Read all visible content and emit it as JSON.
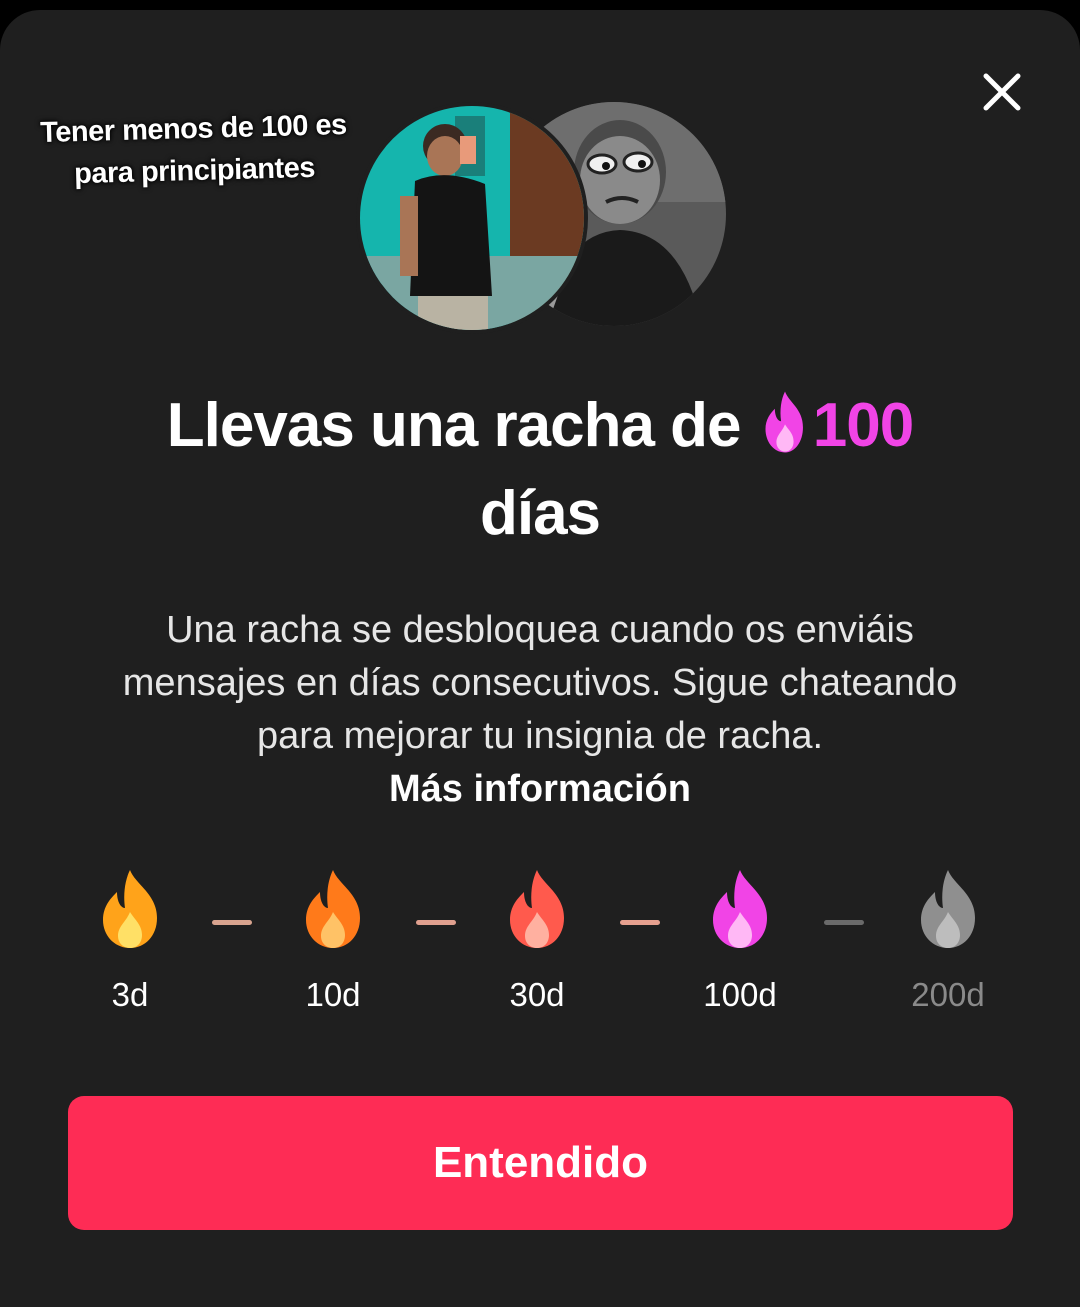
{
  "caption": {
    "line1": "Tener menos de 100 es",
    "line2": "para principiantes"
  },
  "close_icon": "close-icon",
  "title": {
    "prefix": "Llevas una racha de ",
    "count": "100",
    "suffix": "días"
  },
  "description": {
    "text": "Una racha se desbloquea cuando os enviáis mensajes en días consecutivos. Sigue chateando para mejorar tu insignia de racha.",
    "more_link": "Más información"
  },
  "milestones": [
    {
      "label": "3d",
      "color": "#ffa31a",
      "state": "reached"
    },
    {
      "label": "10d",
      "color": "#ff7a1a",
      "state": "reached"
    },
    {
      "label": "30d",
      "color": "#ff5a4d",
      "state": "reached"
    },
    {
      "label": "100d",
      "color": "#f144e6",
      "state": "current"
    },
    {
      "label": "200d",
      "color": "#9a9a9a",
      "state": "locked"
    }
  ],
  "button": {
    "label": "Entendido"
  },
  "colors": {
    "accent": "#fe2c55",
    "streak": "#f144e6",
    "background": "#1f1f1f"
  }
}
